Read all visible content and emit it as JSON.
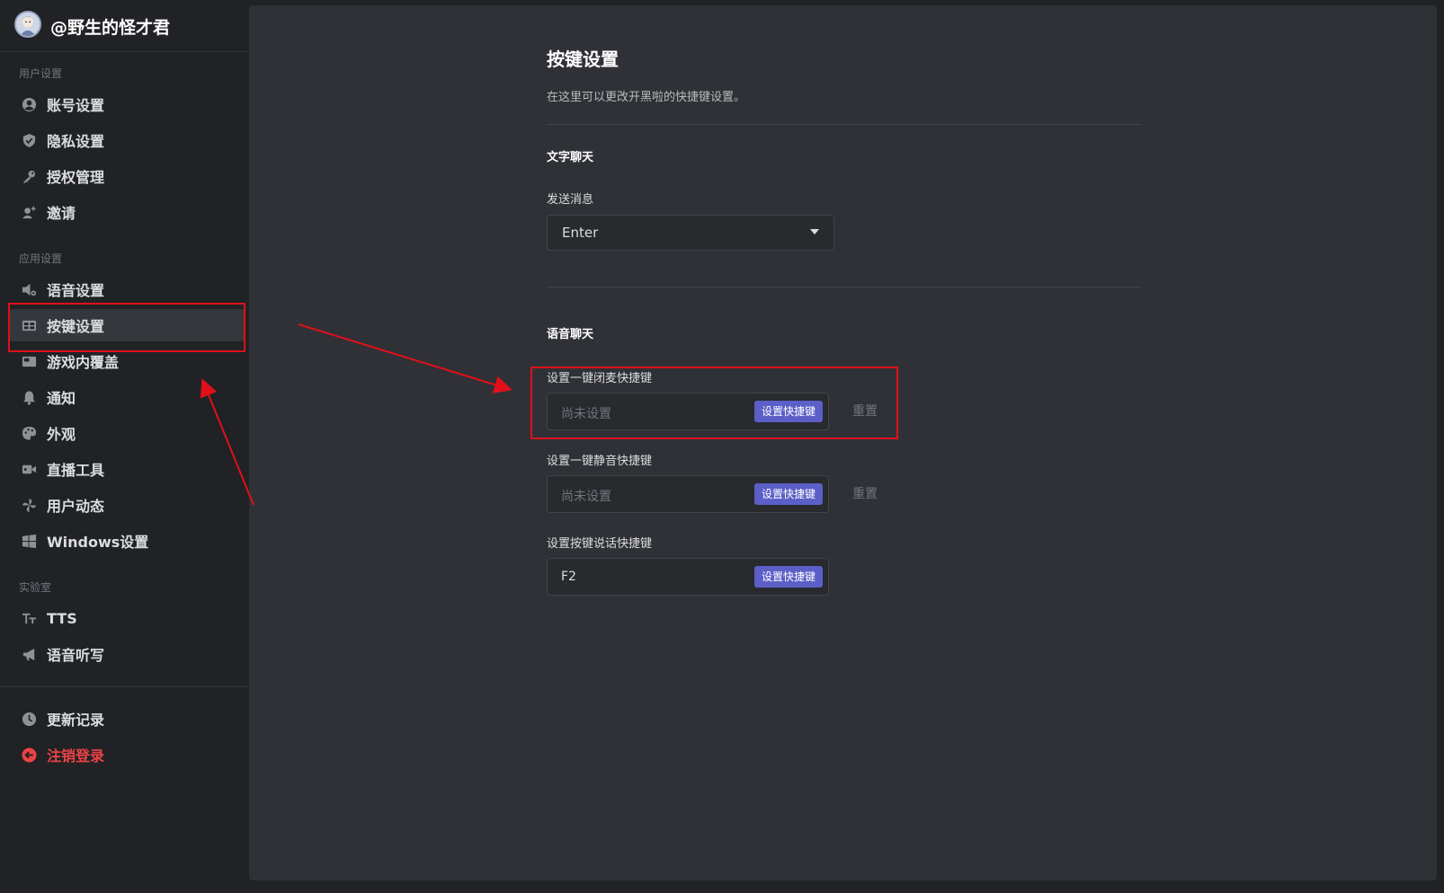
{
  "user": {
    "name": "@野生的怪才君"
  },
  "sidebar": {
    "sections": {
      "user_settings": "用户设置",
      "app_settings": "应用设置",
      "lab": "实验室"
    },
    "items": [
      {
        "label": "账号设置",
        "icon": "user-circle-icon"
      },
      {
        "label": "隐私设置",
        "icon": "shield-icon"
      },
      {
        "label": "授权管理",
        "icon": "key-icon"
      },
      {
        "label": "邀请",
        "icon": "add-user-icon"
      },
      {
        "label": "语音设置",
        "icon": "speaker-gear-icon"
      },
      {
        "label": "按键设置",
        "icon": "keyboard-icon",
        "active": true
      },
      {
        "label": "游戏内覆盖",
        "icon": "overlay-icon"
      },
      {
        "label": "通知",
        "icon": "bell-icon"
      },
      {
        "label": "外观",
        "icon": "palette-icon"
      },
      {
        "label": "直播工具",
        "icon": "camera-icon"
      },
      {
        "label": "用户动态",
        "icon": "pinwheel-icon"
      },
      {
        "label": "Windows设置",
        "icon": "windows-icon"
      },
      {
        "label": "TTS",
        "icon": "text-size-icon"
      },
      {
        "label": "语音听写",
        "icon": "megaphone-icon"
      },
      {
        "label": "更新记录",
        "icon": "clock-icon"
      },
      {
        "label": "注销登录",
        "icon": "logout-icon"
      }
    ]
  },
  "main": {
    "title": "按键设置",
    "description": "在这里可以更改开黑啦的快捷键设置。",
    "text_chat": {
      "title": "文字聊天",
      "send_label": "发送消息",
      "send_value": "Enter"
    },
    "voice_chat": {
      "title": "语音聊天",
      "mic_mute": {
        "label": "设置一键闭麦快捷键",
        "value": "尚未设置",
        "button": "设置快捷键",
        "reset": "重置"
      },
      "mute_all": {
        "label": "设置一键静音快捷键",
        "value": "尚未设置",
        "button": "设置快捷键",
        "reset": "重置"
      },
      "push_to_talk": {
        "label": "设置按键说话快捷键",
        "value": "F2",
        "button": "设置快捷键"
      }
    }
  },
  "colors": {
    "accent": "#5b5fc7",
    "danger": "#ed4245",
    "annotation": "#e0101a",
    "panel": "#2f3136",
    "sidebar": "#202225"
  }
}
